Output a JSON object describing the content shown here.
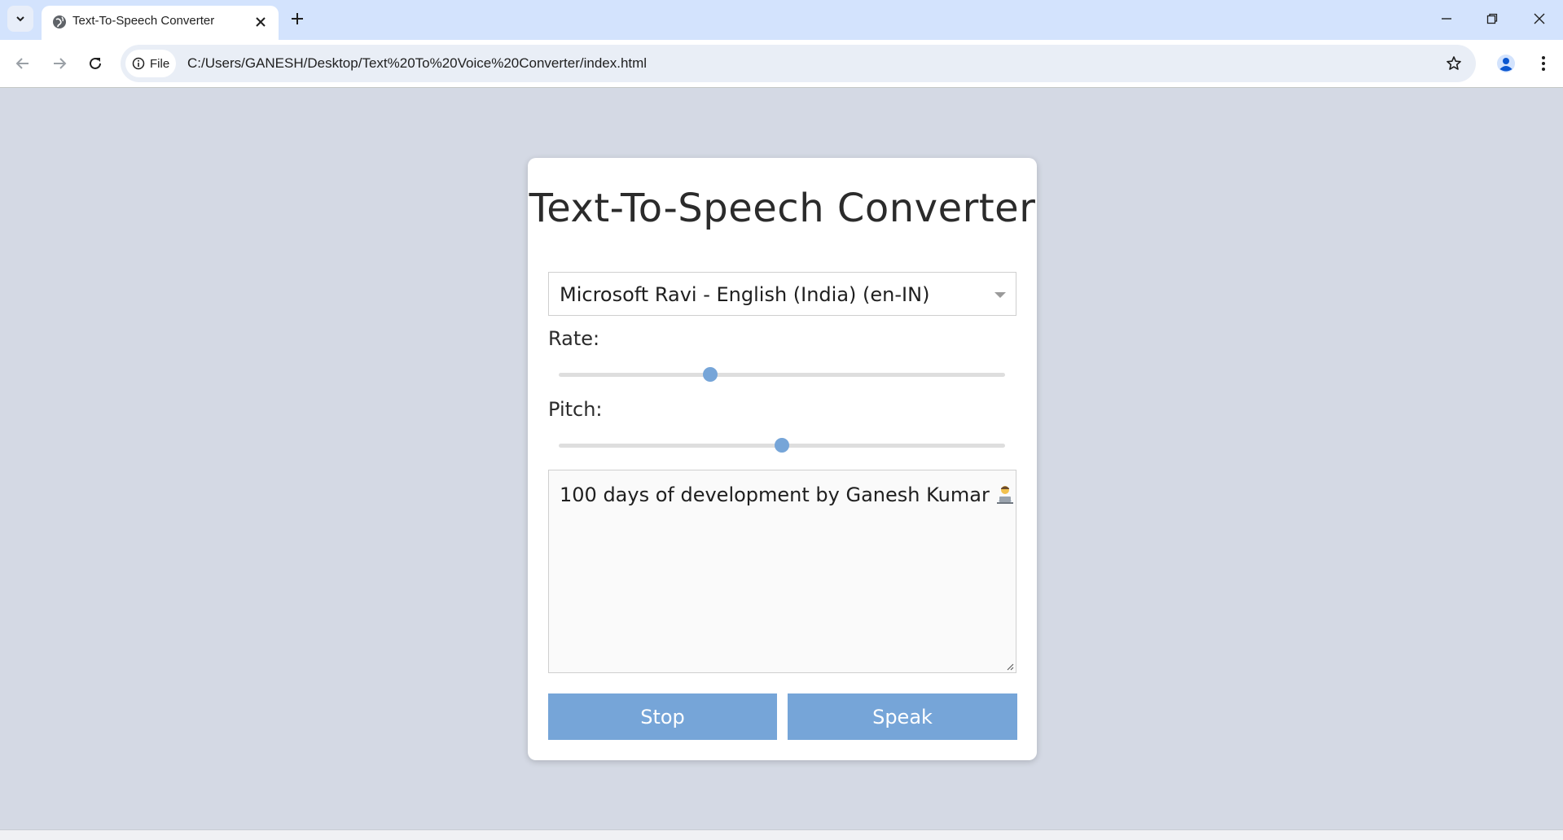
{
  "browser": {
    "tab": {
      "title": "Text-To-Speech Converter"
    },
    "address_bar": {
      "chip_label": "File",
      "url": "C:/Users/GANESH/Desktop/Text%20To%20Voice%20Converter/index.html"
    },
    "icons": [
      "tab-list-icon",
      "globe-icon",
      "close-icon",
      "plus-icon",
      "minimize-icon",
      "restore-icon",
      "close-window-icon",
      "back-arrow-icon",
      "forward-arrow-icon",
      "reload-icon",
      "info-icon",
      "star-icon",
      "profile-icon",
      "kebab-menu-icon"
    ]
  },
  "app": {
    "title": "Text-To-Speech Converter",
    "voice": {
      "selected": "Microsoft Ravi - English (India) (en-IN)"
    },
    "rate": {
      "label": "Rate:",
      "value_fraction": 0.34
    },
    "pitch": {
      "label": "Pitch:",
      "value_fraction": 0.5
    },
    "text_input": {
      "value": "100 days of development by Ganesh Kumar"
    },
    "buttons": {
      "stop": "Stop",
      "speak": "Speak"
    },
    "colors": {
      "accent": "#76a5d8",
      "background": "#d4d9e4",
      "card": "#ffffff"
    }
  }
}
